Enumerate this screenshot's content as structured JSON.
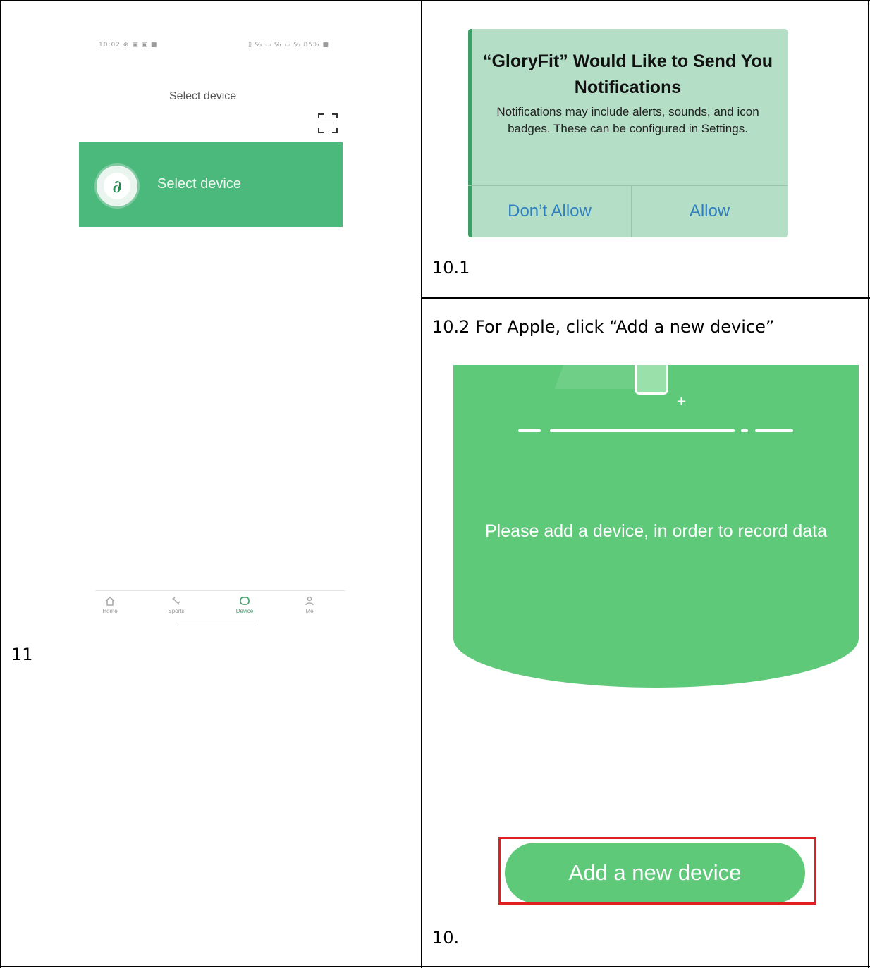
{
  "left_cell": {
    "caption": "11",
    "phone": {
      "status_left": "10:02 ⊕ ▣ ▣ ■",
      "status_right": "▯ ℅ ▭ ℅ ▭ ℅ 85% ■",
      "title": "Select device",
      "banner_label": "Select device",
      "logo_glyph": "∂",
      "tabs": [
        {
          "label": "Home",
          "icon": "home-icon",
          "active": false
        },
        {
          "label": "Sports",
          "icon": "sports-icon",
          "active": false
        },
        {
          "label": "Device",
          "icon": "device-icon",
          "active": true
        },
        {
          "label": "Me",
          "icon": "person-icon",
          "active": false
        }
      ],
      "accent_color": "#4cb97c"
    }
  },
  "top_right_cell": {
    "caption": "10.1",
    "dialog": {
      "title": "“GloryFit” Would Like to Send You Notifications",
      "message": "Notifications may include alerts, sounds, and icon badges. These can be configured in Settings.",
      "deny_label": "Don’t Allow",
      "allow_label": "Allow"
    }
  },
  "bottom_right_cell": {
    "heading": "10.2 For Apple, click “Add a new device”",
    "panel_text": "Please add a device, in order to record data",
    "add_button_label": "Add a new device",
    "caption": "10.",
    "highlight_color": "#e02020",
    "panel_color": "#5fc97a"
  }
}
